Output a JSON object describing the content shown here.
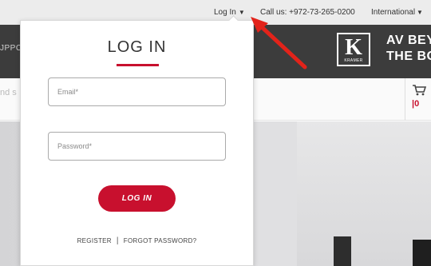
{
  "topbar": {
    "login_label": "Log In",
    "login_caret": "▼",
    "call_us": "Call us: +972-73-265-0200",
    "region_label": "International",
    "region_caret": "▼"
  },
  "header": {
    "support_stub": "JPPC",
    "logo_mark": "K",
    "logo_wordmark": "KRAMER",
    "tagline_line1": "AV BEY",
    "tagline_line2": "THE BO"
  },
  "subbar": {
    "search_stub": "nd s",
    "cart_count": "|0"
  },
  "login_panel": {
    "title": "LOG IN",
    "email_placeholder": "Email*",
    "password_placeholder": "Password*",
    "submit_label": "LOG IN",
    "register_label": "REGISTER",
    "separator": "|",
    "forgot_label": "FORGOT PASSWORD?"
  },
  "colors": {
    "accent_red": "#c8102e",
    "header_dark": "#3c3c3c",
    "topbar_bg": "#ececec",
    "annotation_arrow": "#e2231a"
  }
}
